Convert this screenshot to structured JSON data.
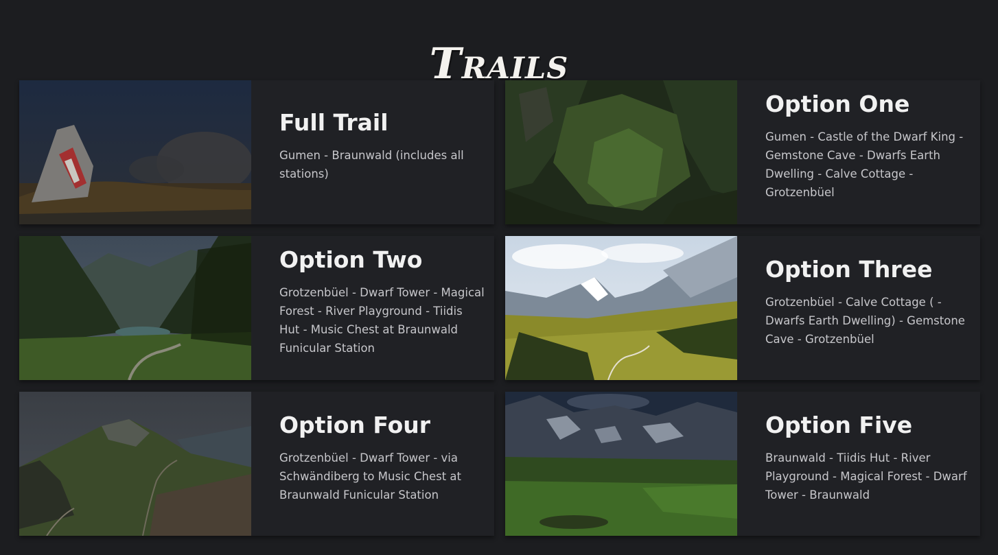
{
  "page": {
    "title": "Trails"
  },
  "trails": [
    {
      "title": "Full Trail",
      "description": "Gumen - Braunwald (includes all stations)",
      "image": "rock-trail-marker-photo"
    },
    {
      "title": "Option One",
      "description": "Gumen - Castle of the Dwarf King - Gemstone Cave - Dwarfs Earth Dwelling - Calve Cottage - Grotzenbüel",
      "image": "green-valley-aerial-photo"
    },
    {
      "title": "Option Two",
      "description": "Grotzenbüel - Dwarf Tower - Magical Forest - River Playground - Tiidis Hut - Music Chest at Braunwald Funicular Station",
      "image": "alpine-lake-valley-photo"
    },
    {
      "title": "Option Three",
      "description": "Grotzenbüel - Calve Cottage ( - Dwarfs Earth Dwelling) - Gemstone Cave - Grotzenbüel",
      "image": "mountain-meadow-photo"
    },
    {
      "title": "Option Four",
      "description": "Grotzenbüel - Dwarf Tower - via Schwändiberg to Music Chest at Braunwald Funicular Station",
      "image": "mountain-peak-path-photo"
    },
    {
      "title": "Option Five",
      "description": "Braunwald - Tiidis Hut - River Playground - Magical Forest - Dwarf Tower - Braunwald",
      "image": "snowy-peaks-pasture-photo"
    }
  ]
}
